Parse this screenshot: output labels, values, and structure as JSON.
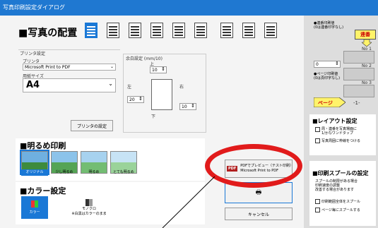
{
  "window": {
    "title": "写真印刷設定ダイアログ"
  },
  "photo_layout": {
    "title": "■写真の配置",
    "buttons": [
      "layout-1",
      "layout-2",
      "layout-3",
      "layout-4",
      "layout-5",
      "layout-6",
      "layout-7",
      "layout-8",
      "layout-9"
    ]
  },
  "printer": {
    "section_label": "プリンタ設定",
    "printer_label": "プリンタ",
    "printer_value": "Microsoft Print to PDF",
    "paper_label": "用紙サイズ",
    "paper_value": "A4",
    "settings_button": "プリンタの設定"
  },
  "margins": {
    "title": "余白設定 (mm/10)",
    "top_label": "上",
    "top_value": "10",
    "left_label": "左",
    "left_value": "20",
    "right_label": "右",
    "right_value": "10",
    "bottom_label": "下",
    "bottom_value": "10"
  },
  "brightness": {
    "title": "■明るめ印刷",
    "options": [
      "オリジナル",
      "少し明るめ",
      "明るめ",
      "とても明るめ"
    ]
  },
  "color": {
    "title": "■カラー設定",
    "color_label": "カラー",
    "mono_label": "モノクロ",
    "mono_note": "※白黒はカラーのまま"
  },
  "actions": {
    "preview_line1": "PDFでプレビュー（テスト印刷）",
    "preview_line2": "Microsoft Print to PDF",
    "pdf_badge": "PDF",
    "cancel": "キャンセル"
  },
  "right_panel": {
    "note1_line1": "●連番印刷値",
    "note1_line2": "(0は連番印字なし)",
    "spin1_value": "0",
    "serial_button": "連番",
    "no1": "No 1",
    "no2": "No 2",
    "no3": "No 3",
    "note2_line1": "●ページ印刷値",
    "note2_line2": "(0は頁印字なし)",
    "spin2_value": "0",
    "spin3_value": "1",
    "page_button": "ページ",
    "page_label": "-1-",
    "layout_title": "■レイアウト設定",
    "layout_opt1_line1": "周・連番を写真場面に",
    "layout_opt1_line2": "1/かなワンドタップ",
    "layout_opt2": "写真周囲に枠線をつける",
    "spool_title": "■印刷スプールの設定",
    "spool_desc1": "スプールの制限がある場合",
    "spool_desc2": "印刷速度の調整",
    "spool_desc3": "改善する場合があります",
    "spool_opt1": "印刷範囲全体をスプール",
    "spool_opt2": "ページ毎にスプールする"
  }
}
